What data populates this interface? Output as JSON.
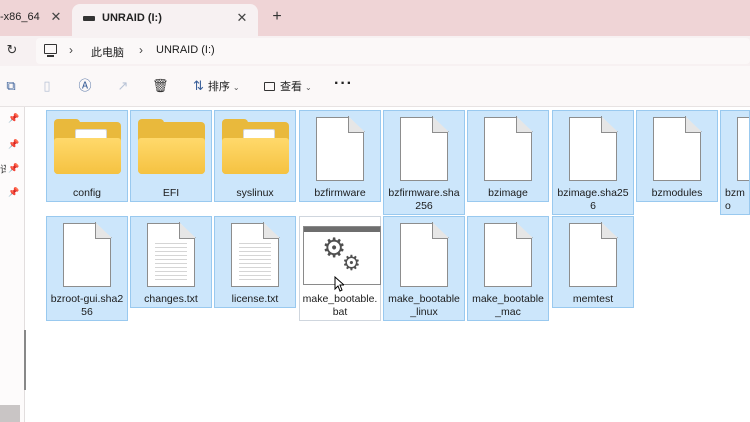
{
  "tabs": {
    "prev_title": "-x86_64",
    "active_title": "UNRAID (I:)",
    "close_glyph": "✕",
    "new_tab_glyph": "+"
  },
  "address": {
    "crumbs": [
      "此电脑",
      "UNRAID (I:)"
    ]
  },
  "toolbar": {
    "sort_label": "排序",
    "view_label": "查看",
    "more_glyph": "···",
    "icons": [
      "copy-icon",
      "paste-icon",
      "rename-icon",
      "share-icon",
      "delete-icon"
    ]
  },
  "navpane": {
    "partial_text": "译"
  },
  "files": [
    {
      "name": "config",
      "type": "folder"
    },
    {
      "name": "EFI",
      "type": "folder"
    },
    {
      "name": "syslinux",
      "type": "folder"
    },
    {
      "name": "bzfirmware",
      "type": "file"
    },
    {
      "name": "bzfirmware.sha256",
      "type": "file"
    },
    {
      "name": "bzimage",
      "type": "file"
    },
    {
      "name": "bzimage.sha256",
      "type": "file"
    },
    {
      "name": "bzmodules",
      "type": "file"
    },
    {
      "name": "bzmo",
      "type": "file"
    },
    {
      "name": "bzroot-gui.sha256",
      "type": "file"
    },
    {
      "name": "changes.txt",
      "type": "text"
    },
    {
      "name": "license.txt",
      "type": "text"
    },
    {
      "name": "make_bootable.bat",
      "type": "batch"
    },
    {
      "name": "make_bootable_linux",
      "type": "file"
    },
    {
      "name": "make_bootable_mac",
      "type": "file"
    },
    {
      "name": "memtest",
      "type": "file"
    }
  ],
  "colors": {
    "tabbar": "#efd4d6",
    "selection": "#cce6fb",
    "selection_border": "#99c9ef",
    "folder": "#f5c241",
    "accent_icon": "#3a5f99"
  }
}
